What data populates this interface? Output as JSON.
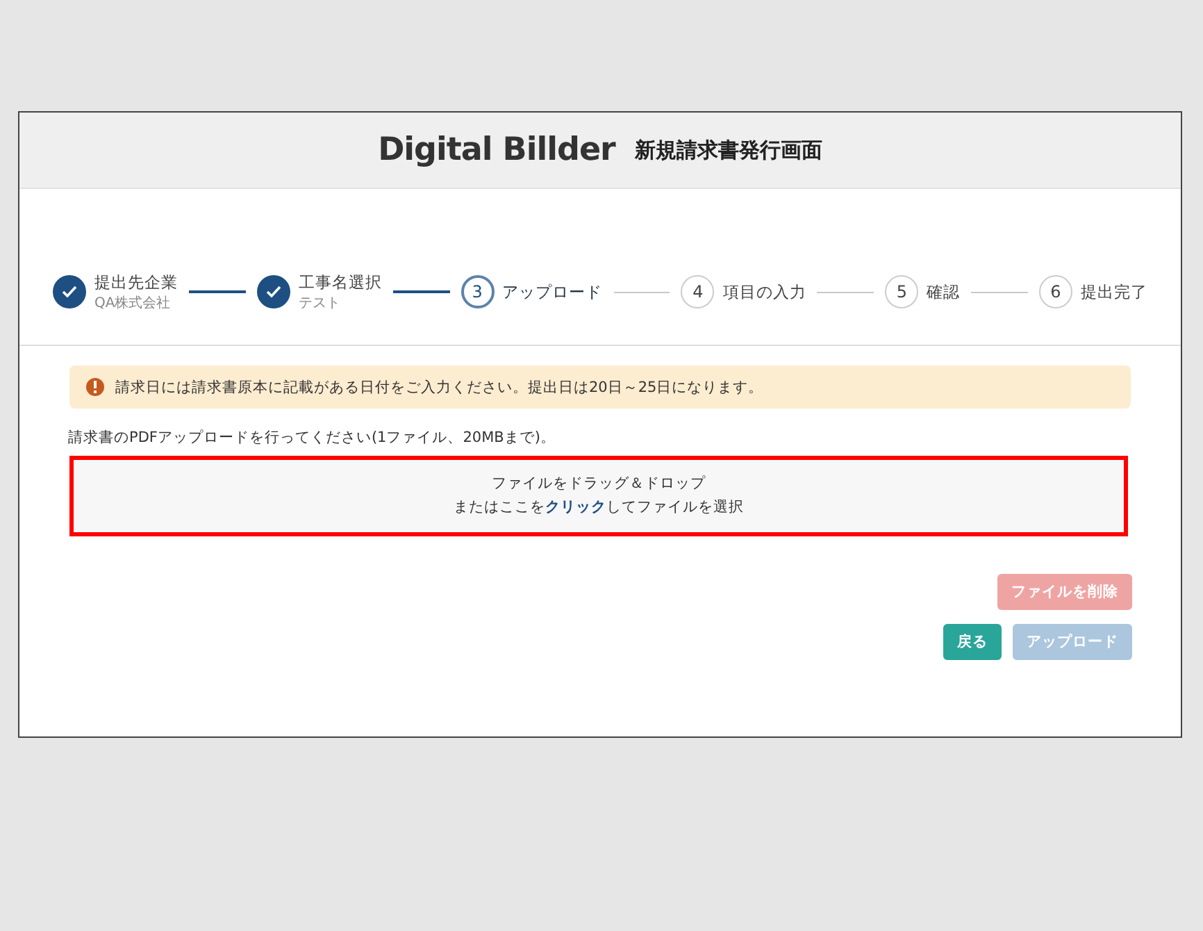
{
  "header": {
    "logo": "Digital Billder",
    "title": "新規請求書発行画面"
  },
  "steps": [
    {
      "label": "提出先企業",
      "sub": "QA株式会社",
      "done": true,
      "current": false
    },
    {
      "label": "工事名選択",
      "sub": "テスト",
      "done": true,
      "current": false
    },
    {
      "number": "3",
      "label": "アップロード",
      "done": false,
      "current": true
    },
    {
      "number": "4",
      "label": "項目の入力",
      "done": false,
      "current": false
    },
    {
      "number": "5",
      "label": "確認",
      "done": false,
      "current": false
    },
    {
      "number": "6",
      "label": "提出完了",
      "done": false,
      "current": false
    }
  ],
  "alert": {
    "text": "請求日には請求書原本に記載がある日付をご入力ください。提出日は20日～25日になります。"
  },
  "instruction": "請求書のPDFアップロードを行ってください(1ファイル、20MBまで)。",
  "dropzone": {
    "line1": "ファイルをドラッグ＆ドロップ",
    "line2_before": "またはここを",
    "line2_link": "クリック",
    "line2_after": "してファイルを選択",
    "highlighted": true
  },
  "buttons": [
    {
      "kind": "delete",
      "label": "ファイルを削除",
      "disabled": true
    },
    {
      "kind": "back",
      "label": "戻る",
      "disabled": false
    },
    {
      "kind": "upload",
      "label": "アップロード",
      "disabled": true
    }
  ]
}
